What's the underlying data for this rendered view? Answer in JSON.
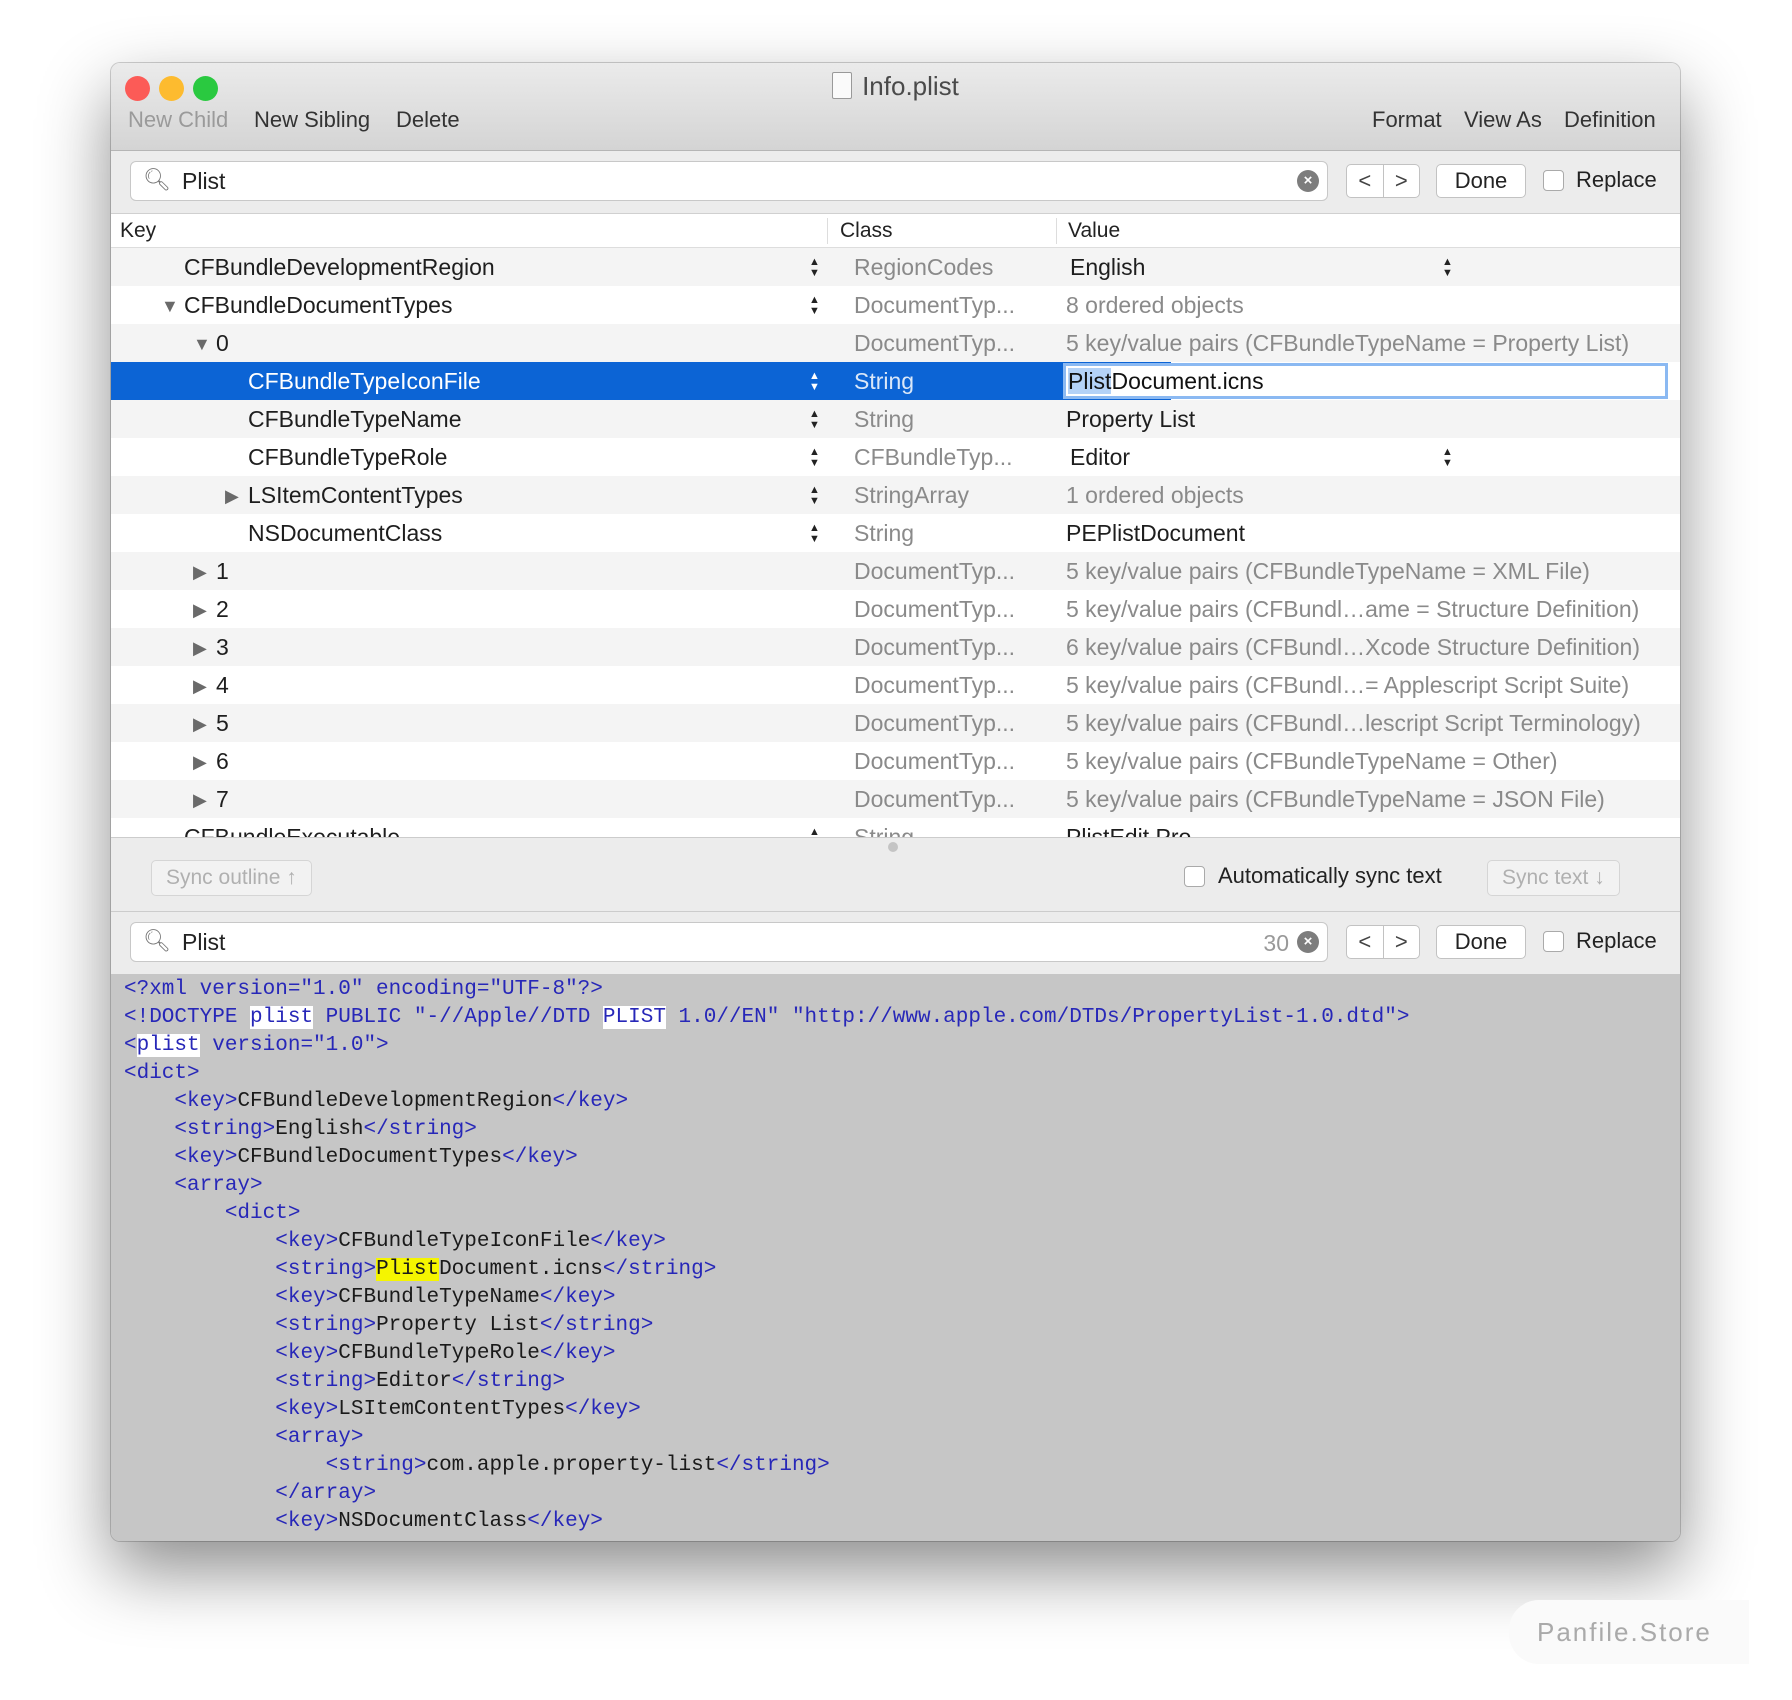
{
  "window": {
    "title": "Info.plist",
    "traffic_lights": {
      "close": "#fc5b57",
      "minimize": "#fdbb2f",
      "zoom": "#2ac940"
    }
  },
  "toolbar": {
    "new_child": "New Child",
    "new_sibling": "New Sibling",
    "delete": "Delete",
    "format": "Format",
    "view_as": "View As",
    "definition": "Definition"
  },
  "search_top": {
    "value": "Plist",
    "prev": "<",
    "next": ">",
    "done": "Done",
    "replace": "Replace"
  },
  "columns": {
    "key": "Key",
    "class": "Class",
    "value": "Value"
  },
  "rows": [
    {
      "key": "CFBundleDevelopmentRegion",
      "level": 0,
      "toggle": "",
      "stepper": true,
      "class": "RegionCodes",
      "value": "English",
      "value_style": "popup"
    },
    {
      "key": "CFBundleDocumentTypes",
      "level": 0,
      "toggle": "expanded",
      "stepper": true,
      "class": "DocumentTyp...",
      "value": "8 ordered objects",
      "value_style": "gray"
    },
    {
      "key": "0",
      "level": 1,
      "toggle": "expanded",
      "stepper": false,
      "class": "DocumentTyp...",
      "value": "5 key/value pairs (CFBundleTypeName = Property List)",
      "value_style": "gray"
    },
    {
      "key": "CFBundleTypeIconFile",
      "level": 2,
      "toggle": "",
      "stepper": true,
      "class": "String",
      "value": "PlistDocument.icns",
      "value_style": "editing",
      "selected": true,
      "value_highlight": "Plist",
      "value_rest": "Document.icns"
    },
    {
      "key": "CFBundleTypeName",
      "level": 2,
      "toggle": "",
      "stepper": true,
      "class": "String",
      "value": "Property List",
      "value_style": "plain"
    },
    {
      "key": "CFBundleTypeRole",
      "level": 2,
      "toggle": "",
      "stepper": true,
      "class": "CFBundleTyp...",
      "value": "Editor",
      "value_style": "popup"
    },
    {
      "key": "LSItemContentTypes",
      "level": 2,
      "toggle": "collapsed",
      "stepper": true,
      "class": "StringArray",
      "value": "1 ordered objects",
      "value_style": "gray"
    },
    {
      "key": "NSDocumentClass",
      "level": 2,
      "toggle": "",
      "stepper": true,
      "class": "String",
      "value": "PEPlistDocument",
      "value_style": "plain"
    },
    {
      "key": "1",
      "level": 1,
      "toggle": "collapsed",
      "stepper": false,
      "class": "DocumentTyp...",
      "value": "5 key/value pairs (CFBundleTypeName = XML File)",
      "value_style": "gray"
    },
    {
      "key": "2",
      "level": 1,
      "toggle": "collapsed",
      "stepper": false,
      "class": "DocumentTyp...",
      "value": "5 key/value pairs (CFBundl…ame = Structure Definition)",
      "value_style": "gray"
    },
    {
      "key": "3",
      "level": 1,
      "toggle": "collapsed",
      "stepper": false,
      "class": "DocumentTyp...",
      "value": "6 key/value pairs (CFBundl…Xcode Structure Definition)",
      "value_style": "gray"
    },
    {
      "key": "4",
      "level": 1,
      "toggle": "collapsed",
      "stepper": false,
      "class": "DocumentTyp...",
      "value": "5 key/value pairs (CFBundl…= Applescript Script Suite)",
      "value_style": "gray"
    },
    {
      "key": "5",
      "level": 1,
      "toggle": "collapsed",
      "stepper": false,
      "class": "DocumentTyp...",
      "value": "5 key/value pairs (CFBundl…lescript Script Terminology)",
      "value_style": "gray"
    },
    {
      "key": "6",
      "level": 1,
      "toggle": "collapsed",
      "stepper": false,
      "class": "DocumentTyp...",
      "value": "5 key/value pairs (CFBundleTypeName = Other)",
      "value_style": "gray"
    },
    {
      "key": "7",
      "level": 1,
      "toggle": "collapsed",
      "stepper": false,
      "class": "DocumentTyp...",
      "value": "5 key/value pairs (CFBundleTypeName = JSON File)",
      "value_style": "gray"
    },
    {
      "key": "CFBundleExecutable",
      "level": 0,
      "toggle": "",
      "stepper": true,
      "class": "String",
      "value": "PlistEdit Pro",
      "value_style": "plain"
    }
  ],
  "sync": {
    "sync_outline": "Sync outline ↑",
    "auto_sync": "Automatically sync text",
    "sync_text": "Sync text ↓"
  },
  "search_bottom": {
    "value": "Plist",
    "count": "30",
    "prev": "<",
    "next": ">",
    "done": "Done",
    "replace": "Replace"
  },
  "code_lines": [
    {
      "indent": 0,
      "segs": [
        [
          "tag",
          "<?xml version=\"1.0\" encoding=\"UTF-8\"?>"
        ]
      ]
    },
    {
      "indent": 0,
      "segs": [
        [
          "tag",
          "<!DOCTYPE "
        ],
        [
          "tag match",
          "plist"
        ],
        [
          "tag",
          " PUBLIC \"-//Apple//DTD "
        ],
        [
          "tag match",
          "PLIST"
        ],
        [
          "tag",
          " 1.0//EN\" \"http://www.apple.com/DTDs/PropertyList-1.0.dtd\">"
        ]
      ]
    },
    {
      "indent": 0,
      "segs": [
        [
          "tag",
          "<"
        ],
        [
          "tag match",
          "plist"
        ],
        [
          "tag",
          " version=\"1.0\">"
        ]
      ]
    },
    {
      "indent": 0,
      "segs": [
        [
          "tag",
          "<dict>"
        ]
      ]
    },
    {
      "indent": 1,
      "segs": [
        [
          "tag",
          "<key>"
        ],
        [
          "text",
          "CFBundleDevelopmentRegion"
        ],
        [
          "tag",
          "</key>"
        ]
      ]
    },
    {
      "indent": 1,
      "segs": [
        [
          "tag",
          "<string>"
        ],
        [
          "text",
          "English"
        ],
        [
          "tag",
          "</string>"
        ]
      ]
    },
    {
      "indent": 1,
      "segs": [
        [
          "tag",
          "<key>"
        ],
        [
          "text",
          "CFBundleDocumentTypes"
        ],
        [
          "tag",
          "</key>"
        ]
      ]
    },
    {
      "indent": 1,
      "segs": [
        [
          "tag",
          "<array>"
        ]
      ]
    },
    {
      "indent": 2,
      "segs": [
        [
          "tag",
          "<dict>"
        ]
      ]
    },
    {
      "indent": 3,
      "segs": [
        [
          "tag",
          "<key>"
        ],
        [
          "text",
          "CFBundleTypeIconFile"
        ],
        [
          "tag",
          "</key>"
        ]
      ]
    },
    {
      "indent": 3,
      "segs": [
        [
          "tag",
          "<string>"
        ],
        [
          "text cur",
          "Plist"
        ],
        [
          "text",
          "Document.icns"
        ],
        [
          "tag",
          "</string>"
        ]
      ]
    },
    {
      "indent": 3,
      "segs": [
        [
          "tag",
          "<key>"
        ],
        [
          "text",
          "CFBundleTypeName"
        ],
        [
          "tag",
          "</key>"
        ]
      ]
    },
    {
      "indent": 3,
      "segs": [
        [
          "tag",
          "<string>"
        ],
        [
          "text",
          "Property List"
        ],
        [
          "tag",
          "</string>"
        ]
      ]
    },
    {
      "indent": 3,
      "segs": [
        [
          "tag",
          "<key>"
        ],
        [
          "text",
          "CFBundleTypeRole"
        ],
        [
          "tag",
          "</key>"
        ]
      ]
    },
    {
      "indent": 3,
      "segs": [
        [
          "tag",
          "<string>"
        ],
        [
          "text",
          "Editor"
        ],
        [
          "tag",
          "</string>"
        ]
      ]
    },
    {
      "indent": 3,
      "segs": [
        [
          "tag",
          "<key>"
        ],
        [
          "text",
          "LSItemContentTypes"
        ],
        [
          "tag",
          "</key>"
        ]
      ]
    },
    {
      "indent": 3,
      "segs": [
        [
          "tag",
          "<array>"
        ]
      ]
    },
    {
      "indent": 4,
      "segs": [
        [
          "tag",
          "<string>"
        ],
        [
          "text",
          "com.apple.property-list"
        ],
        [
          "tag",
          "</string>"
        ]
      ]
    },
    {
      "indent": 3,
      "segs": [
        [
          "tag",
          "</array>"
        ]
      ]
    },
    {
      "indent": 3,
      "segs": [
        [
          "tag",
          "<key>"
        ],
        [
          "text",
          "NSDocumentClass"
        ],
        [
          "tag",
          "</key>"
        ]
      ]
    }
  ],
  "watermark": "Panfile.Store"
}
